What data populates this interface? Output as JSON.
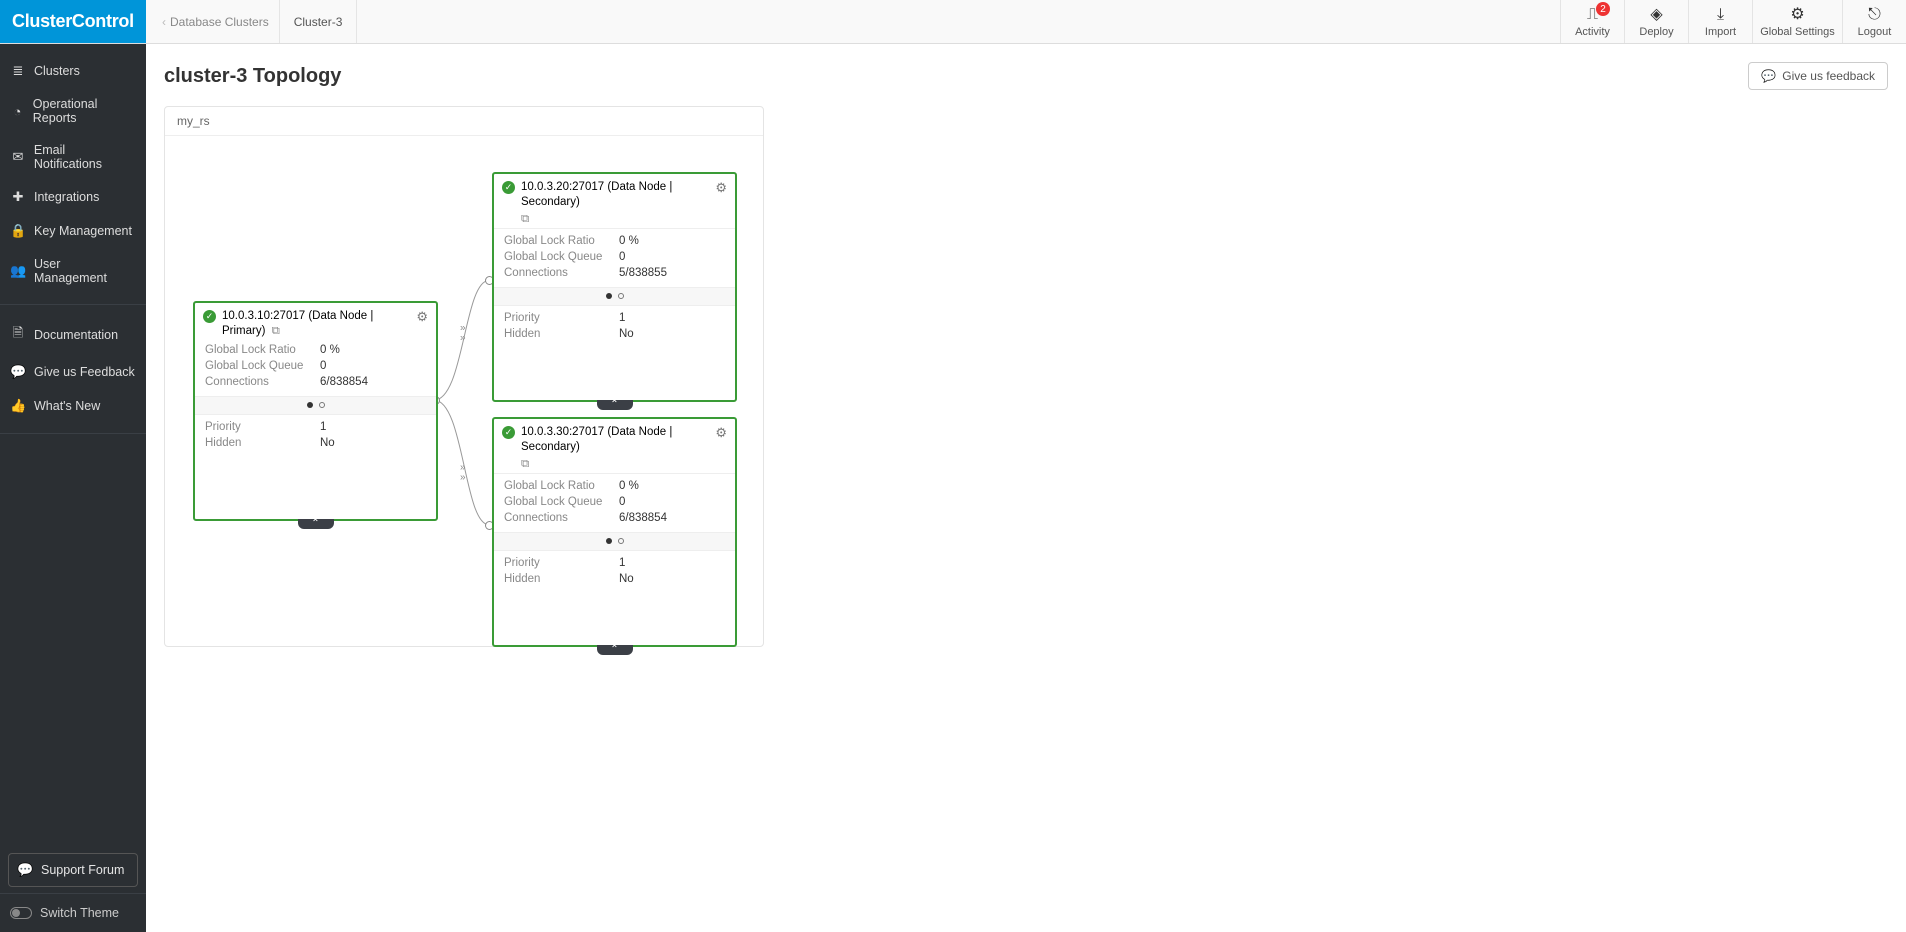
{
  "brand": "ClusterControl",
  "breadcrumb": {
    "parent": "Database Clusters",
    "current": "Cluster-3"
  },
  "top_actions": {
    "activity": "Activity",
    "activity_badge": "2",
    "deploy": "Deploy",
    "import": "Import",
    "global_settings": "Global Settings",
    "logout": "Logout"
  },
  "sidebar": {
    "primary": [
      {
        "icon": "≣",
        "label": "Clusters"
      },
      {
        "icon": "◔",
        "label": "Operational Reports"
      },
      {
        "icon": "✉",
        "label": "Email Notifications"
      },
      {
        "icon": "✚",
        "label": "Integrations"
      },
      {
        "icon": "🔒",
        "label": "Key Management"
      },
      {
        "icon": "👥",
        "label": "User Management"
      }
    ],
    "secondary": [
      {
        "icon": "🗎",
        "label": "Documentation"
      },
      {
        "icon": "💬",
        "label": "Give us Feedback"
      },
      {
        "icon": "👍",
        "label": "What's New"
      }
    ],
    "support": "Support Forum",
    "switch_theme": "Switch Theme"
  },
  "page": {
    "title": "cluster-3 Topology",
    "feedback_button": "Give us feedback"
  },
  "panel": {
    "title": "my_rs"
  },
  "labels": {
    "global_lock_ratio": "Global Lock Ratio",
    "global_lock_queue": "Global Lock Queue",
    "connections": "Connections",
    "priority": "Priority",
    "hidden": "Hidden"
  },
  "nodes": {
    "primary": {
      "title": "10.0.3.10:27017 (Data Node | Primary)",
      "global_lock_ratio": "0 %",
      "global_lock_queue": "0",
      "connections": "6/838854",
      "priority": "1",
      "hidden": "No"
    },
    "secondary1": {
      "title": "10.0.3.20:27017 (Data Node | Secondary)",
      "global_lock_ratio": "0 %",
      "global_lock_queue": "0",
      "connections": "5/838855",
      "priority": "1",
      "hidden": "No"
    },
    "secondary2": {
      "title": "10.0.3.30:27017 (Data Node | Secondary)",
      "global_lock_ratio": "0 %",
      "global_lock_queue": "0",
      "connections": "6/838854",
      "priority": "1",
      "hidden": "No"
    }
  }
}
